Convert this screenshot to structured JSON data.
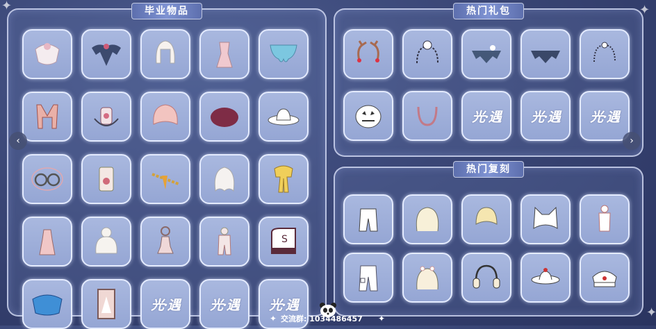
{
  "panels": {
    "graduation": {
      "title": "毕业物品"
    },
    "gift_packs": {
      "title": "热门礼包"
    },
    "reprints": {
      "title": "热门复刻"
    }
  },
  "footer": {
    "text": "交流群: 1034486457"
  },
  "placeholder_logo": "光·遇",
  "graduation_items": [
    "white-cape-icon",
    "bat-cape-icon",
    "white-hair-icon",
    "pink-outfit-icon",
    "blue-cape-icon",
    "red-cape-icon",
    "dragon-mask-icon",
    "pink-shell-cape-icon",
    "maroon-cape-icon",
    "white-hat-icon",
    "glasses-icon",
    "card-prop-icon",
    "gold-chain-icon",
    "white-long-hair-icon",
    "gold-scarf-icon",
    "pink-dress-icon",
    "white-bun-hair-icon",
    "gear-doll-prop-icon",
    "pink-pants-outfit-icon",
    "piano-prop-icon",
    "blue-wing-cape-icon",
    "portrait-card-icon",
    "logo",
    "logo",
    "logo"
  ],
  "gift_items": [
    "antler-icon",
    "crab-hood-icon",
    "dark-cape-icon",
    "dark-cape-2-icon",
    "bead-necklace-icon",
    "pumpkin-mask-icon",
    "pink-necklace-icon",
    "logo",
    "logo",
    "logo"
  ],
  "reprint_items": [
    "white-pants-icon",
    "curly-hair-icon",
    "blond-hair-icon",
    "cat-ear-hair-icon",
    "white-suit-icon",
    "cargo-pants-icon",
    "flower-hair-icon",
    "headphones-icon",
    "boat-hat-icon",
    "captain-hat-icon"
  ]
}
